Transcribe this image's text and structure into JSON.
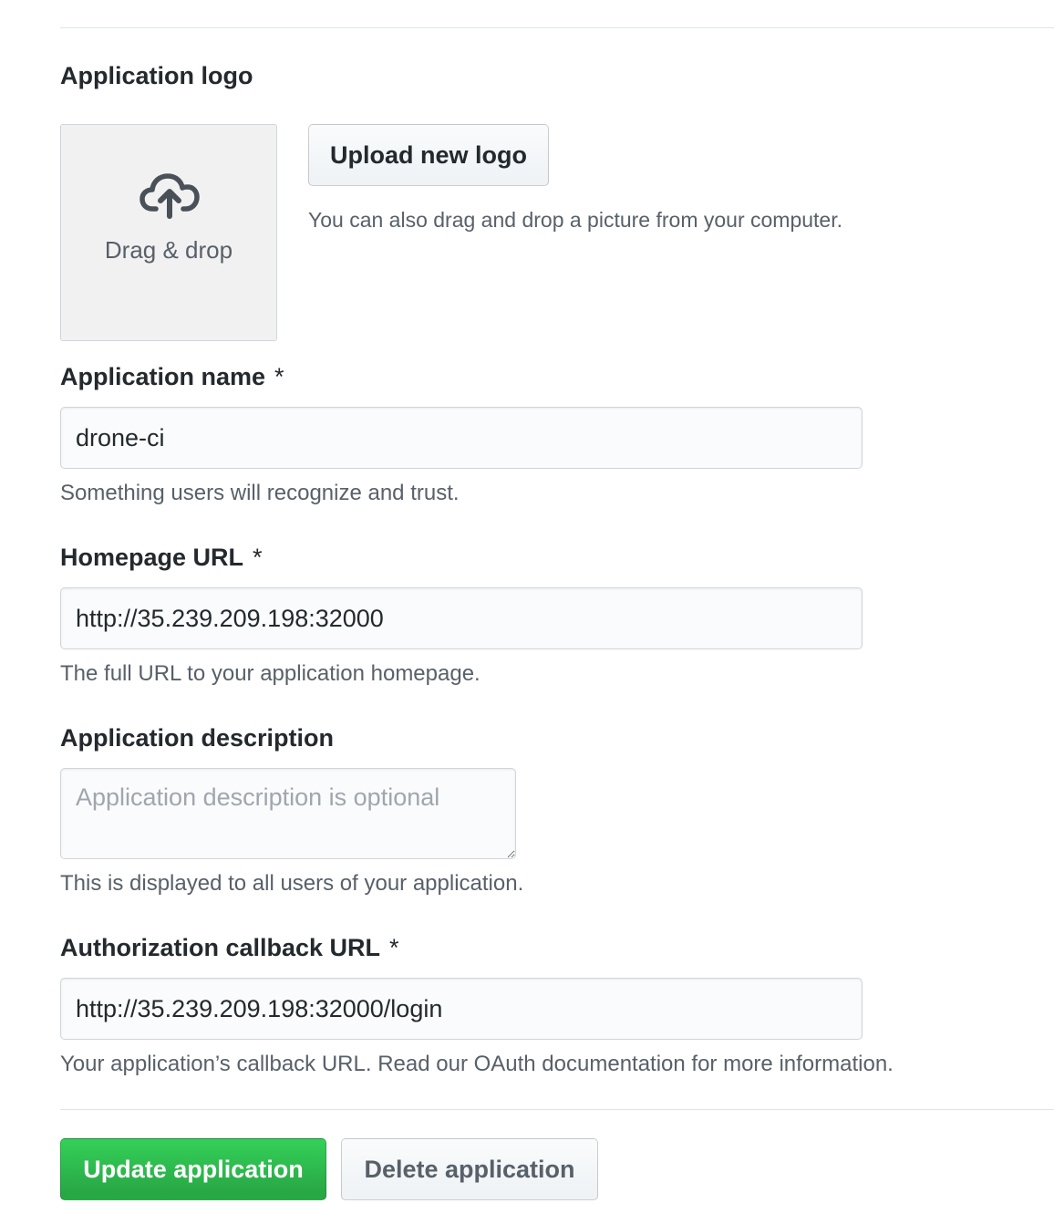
{
  "logo_section": {
    "title": "Application logo",
    "dropzone_label": "Drag & drop",
    "upload_button": "Upload new logo",
    "hint": "You can also drag and drop a picture from your computer."
  },
  "name_field": {
    "label": "Application name",
    "required": "*",
    "value": "drone-ci",
    "note": "Something users will recognize and trust."
  },
  "homepage_field": {
    "label": "Homepage URL",
    "required": "*",
    "value": "http://35.239.209.198:32000",
    "note": "The full URL to your application homepage."
  },
  "description_field": {
    "label": "Application description",
    "placeholder": "Application description is optional",
    "note": "This is displayed to all users of your application."
  },
  "callback_field": {
    "label": "Authorization callback URL",
    "required": "*",
    "value": "http://35.239.209.198:32000/login",
    "note": "Your application’s callback URL. Read our OAuth documentation for more information."
  },
  "actions": {
    "update_label": "Update application",
    "delete_label": "Delete application"
  },
  "icons": {
    "dropzone": "cloud-upload-icon"
  },
  "colors": {
    "primary_button": "#28a745",
    "text_muted": "#586069"
  }
}
